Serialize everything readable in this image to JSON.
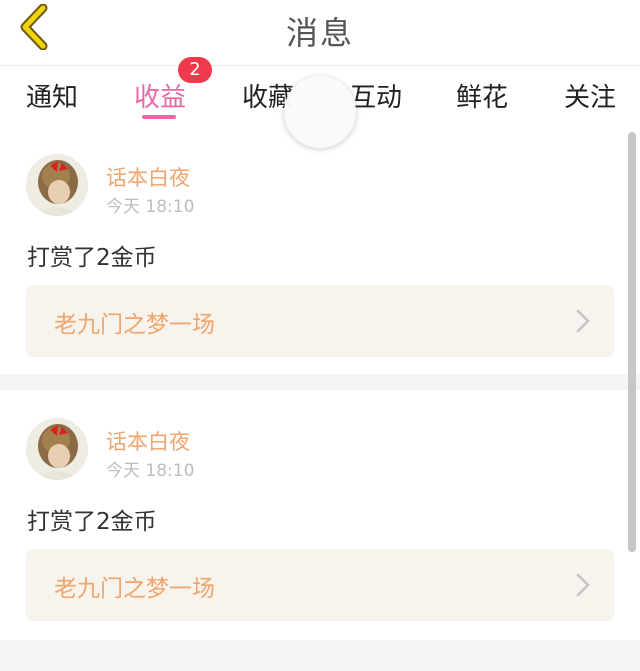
{
  "header": {
    "title": "消息",
    "back_icon": "chevron-left-icon"
  },
  "tabs": [
    {
      "label": "通知",
      "active": false
    },
    {
      "label": "收益",
      "active": true,
      "badge": "2"
    },
    {
      "label": "收藏",
      "active": false
    },
    {
      "label": "互动",
      "active": false
    },
    {
      "label": "鲜花",
      "active": false
    },
    {
      "label": "关注",
      "active": false
    }
  ],
  "messages": [
    {
      "username": "话本白夜",
      "time": "今天 18:10",
      "text": "打赏了2金币",
      "work_title": "老九门之梦一场"
    },
    {
      "username": "话本白夜",
      "time": "今天 18:10",
      "text": "打赏了2金币",
      "work_title": "老九门之梦一场"
    }
  ],
  "colors": {
    "accent": "#ea67a5",
    "badge": "#f0394d",
    "username": "#f0a56f",
    "back_icon": "#f2d20a"
  }
}
